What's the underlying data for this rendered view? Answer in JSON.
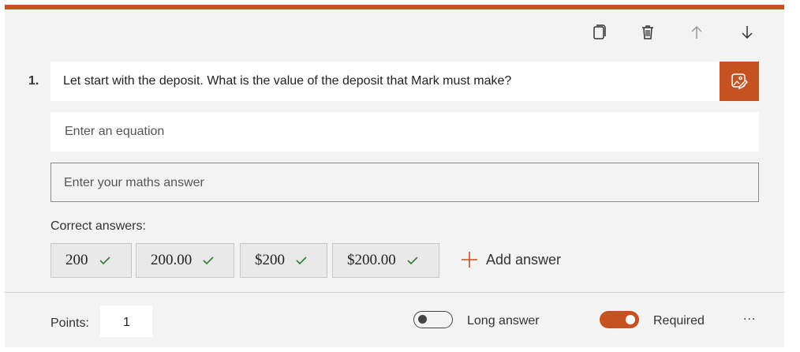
{
  "question": {
    "number": "1.",
    "text": "Let start with the deposit. What is the value of the deposit that Mark must make?"
  },
  "toolbar": {
    "copy_icon": "copy-icon",
    "delete_icon": "trash-icon",
    "up_icon": "arrow-up-icon",
    "down_icon": "arrow-down-icon"
  },
  "equation": {
    "placeholder": "Enter an equation"
  },
  "answer": {
    "placeholder": "Enter your maths answer"
  },
  "correct": {
    "label": "Correct answers:",
    "answers": [
      "200",
      "200.00",
      "$200",
      "$200.00"
    ],
    "add_label": "Add answer"
  },
  "footer": {
    "points_label": "Points:",
    "points_value": "1",
    "long_answer_label": "Long answer",
    "long_answer_on": false,
    "required_label": "Required",
    "required_on": true,
    "more_label": "..."
  },
  "colors": {
    "accent": "#c65221",
    "check": "#2e7d32",
    "card_bg": "#f3f3f3"
  }
}
